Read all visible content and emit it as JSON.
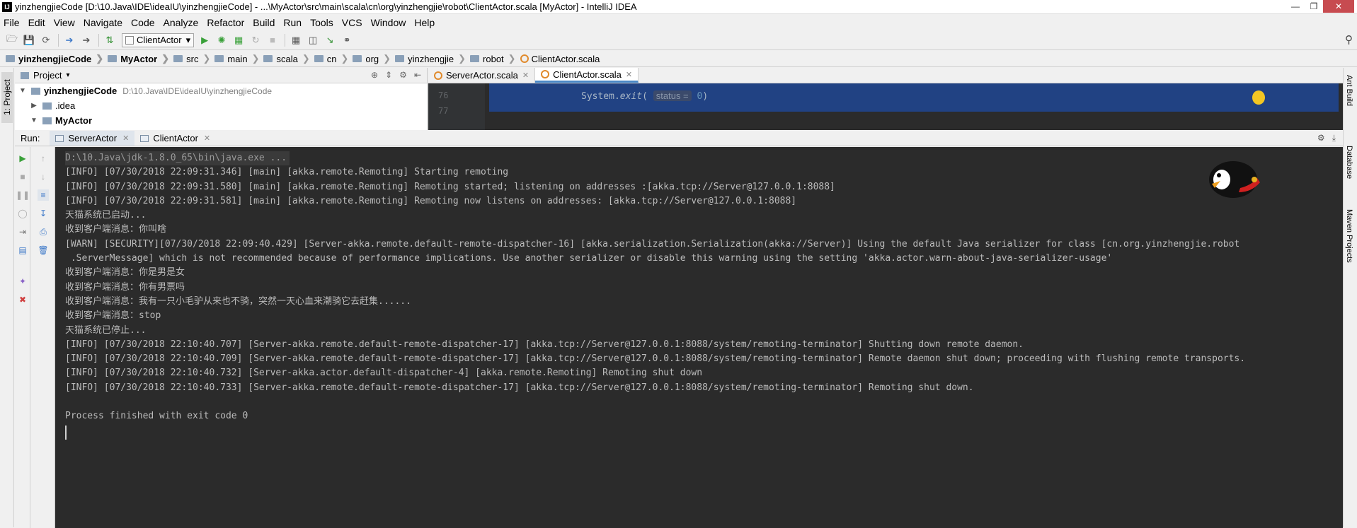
{
  "window": {
    "title": "yinzhengjieCode [D:\\10.Java\\IDE\\ideaIU\\yinzhengjieCode] - ...\\MyActor\\src\\main\\scala\\cn\\org\\yinzhengjie\\robot\\ClientActor.scala [MyActor] - IntelliJ IDEA",
    "app_icon": "IJ"
  },
  "menu": [
    "File",
    "Edit",
    "View",
    "Navigate",
    "Code",
    "Analyze",
    "Refactor",
    "Build",
    "Run",
    "Tools",
    "VCS",
    "Window",
    "Help"
  ],
  "toolbar": {
    "run_config": "ClientActor"
  },
  "breadcrumbs": [
    "yinzhengjieCode",
    "MyActor",
    "src",
    "main",
    "scala",
    "cn",
    "org",
    "yinzhengjie",
    "robot",
    "ClientActor.scala"
  ],
  "left_tool_tab": "1: Project",
  "right_tool_tabs": [
    "Ant Build",
    "Database",
    "Maven Projects"
  ],
  "project": {
    "header": "Project",
    "tree": [
      {
        "label": "yinzhengjieCode",
        "path": "D:\\10.Java\\IDE\\ideaIU\\yinzhengjieCode",
        "expanded": true,
        "bold": true
      },
      {
        "label": ".idea",
        "expanded": false
      },
      {
        "label": "MyActor",
        "expanded": true,
        "bold": true
      }
    ]
  },
  "editor": {
    "tabs": [
      {
        "label": "ServerActor.scala",
        "active": false
      },
      {
        "label": "ClientActor.scala",
        "active": true
      }
    ],
    "line_no": "76",
    "line_no_next": "77",
    "code_prefix": "System.",
    "code_method": "exit",
    "code_open": "( ",
    "param_hint": "status =",
    "param_value": "0",
    "code_close": ")"
  },
  "run": {
    "label": "Run:",
    "tabs": [
      {
        "label": "ServerActor",
        "active": true
      },
      {
        "label": "ClientActor",
        "active": false
      }
    ]
  },
  "console": {
    "command": "D:\\10.Java\\jdk-1.8.0_65\\bin\\java.exe ...",
    "lines": [
      "[INFO] [07/30/2018 22:09:31.346] [main] [akka.remote.Remoting] Starting remoting",
      "[INFO] [07/30/2018 22:09:31.580] [main] [akka.remote.Remoting] Remoting started; listening on addresses :[akka.tcp://Server@127.0.0.1:8088]",
      "[INFO] [07/30/2018 22:09:31.581] [main] [akka.remote.Remoting] Remoting now listens on addresses: [akka.tcp://Server@127.0.0.1:8088]",
      "天猫系统已启动...",
      "收到客户端消息：你叫啥",
      "[WARN] [SECURITY][07/30/2018 22:09:40.429] [Server-akka.remote.default-remote-dispatcher-16] [akka.serialization.Serialization(akka://Server)] Using the default Java serializer for class [cn.org.yinzhengjie.robot",
      " .ServerMessage] which is not recommended because of performance implications. Use another serializer or disable this warning using the setting 'akka.actor.warn-about-java-serializer-usage'",
      "收到客户端消息：你是男是女",
      "收到客户端消息：你有男票吗",
      "收到客户端消息：我有一只小毛驴从来也不骑，突然一天心血来潮骑它去赶集......",
      "收到客户端消息：stop",
      "天猫系统已停止...",
      "[INFO] [07/30/2018 22:10:40.707] [Server-akka.remote.default-remote-dispatcher-17] [akka.tcp://Server@127.0.0.1:8088/system/remoting-terminator] Shutting down remote daemon.",
      "[INFO] [07/30/2018 22:10:40.709] [Server-akka.remote.default-remote-dispatcher-17] [akka.tcp://Server@127.0.0.1:8088/system/remoting-terminator] Remote daemon shut down; proceeding with flushing remote transports.",
      "[INFO] [07/30/2018 22:10:40.732] [Server-akka.actor.default-dispatcher-4] [akka.remote.Remoting] Remoting shut down",
      "[INFO] [07/30/2018 22:10:40.733] [Server-akka.remote.default-remote-dispatcher-17] [akka.tcp://Server@127.0.0.1:8088/system/remoting-terminator] Remoting shut down.",
      "",
      "Process finished with exit code 0"
    ]
  },
  "colors": {
    "console_bg": "#2b2b2b",
    "console_text": "#bbbbbb",
    "selection_bg": "#214283",
    "accent": "#4a88c7"
  }
}
